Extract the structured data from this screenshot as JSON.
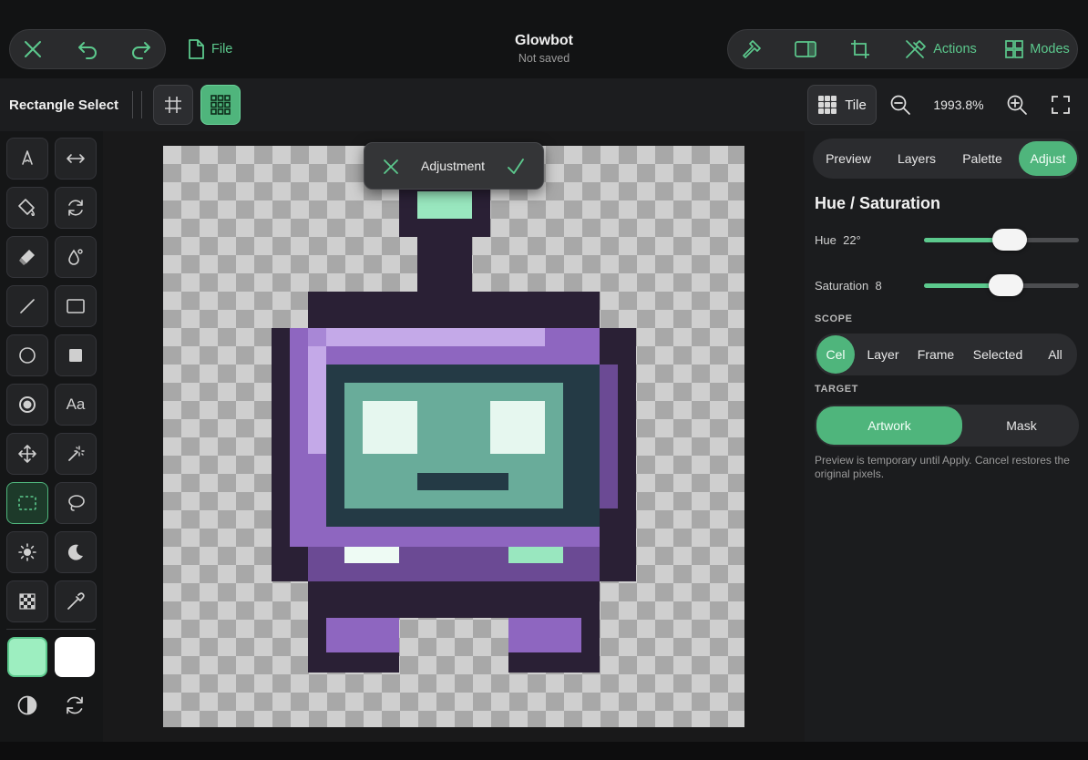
{
  "document": {
    "title": "Glowbot",
    "status": "Not saved"
  },
  "topbar": {
    "file_label": "File",
    "actions_label": "Actions",
    "modes_label": "Modes"
  },
  "toolbar": {
    "tool_name": "Rectangle Select",
    "tile_label": "Tile",
    "zoom": "1993.8%"
  },
  "popover": {
    "label": "Adjustment"
  },
  "right_panel": {
    "tabs": [
      "Preview",
      "Layers",
      "Palette",
      "Adjust"
    ],
    "active_tab": "Adjust",
    "section_title": "Hue / Saturation",
    "hue": {
      "label": "Hue",
      "value": "22°",
      "level": 0.55
    },
    "saturation": {
      "label": "Saturation",
      "value": "8",
      "level": 0.53
    },
    "scope_label": "SCOPE",
    "scope_options": [
      "Cel",
      "Layer",
      "Frame",
      "Selected",
      "All"
    ],
    "scope_selected": "Cel",
    "target_label": "TARGET",
    "target_options": [
      "Artwork",
      "Mask"
    ],
    "target_selected": "Artwork",
    "note": "Preview is temporary until Apply. Cancel restores the original pixels."
  },
  "tools": {
    "text_tool_label": "Aa",
    "primary_color": "#9deec0",
    "secondary_color": "#ffffff"
  },
  "colors": {
    "accent": "#5cc98d"
  }
}
